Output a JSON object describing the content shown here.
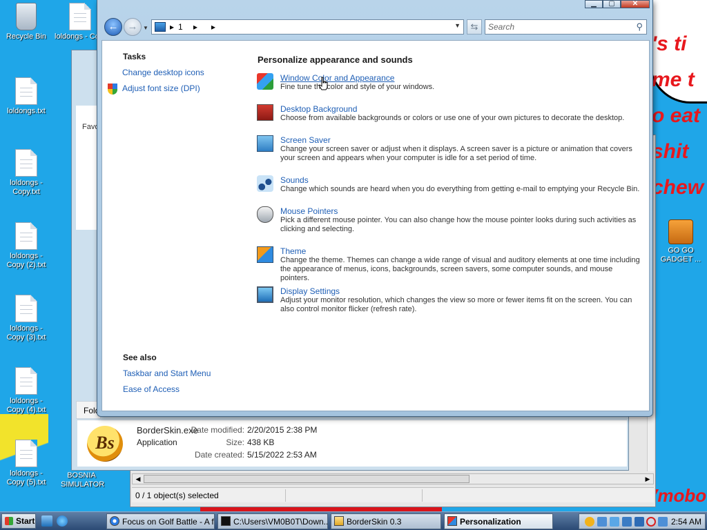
{
  "desktop": {
    "icons": [
      {
        "id": "recycle-bin",
        "label": "Recycle Bin"
      },
      {
        "id": "loldongs-copy-top",
        "label": "loldongs - Co..."
      },
      {
        "id": "loldongs",
        "label": "loldongs.txt"
      },
      {
        "id": "loldongs-copy",
        "label": "loldongs - Copy.txt"
      },
      {
        "id": "loldongs-copy-2",
        "label": "loldongs - Copy (2).txt"
      },
      {
        "id": "loldongs-copy-3",
        "label": "loldongs - Copy (3).txt"
      },
      {
        "id": "loldongs-copy-4",
        "label": "loldongs - Copy (4).txt"
      },
      {
        "id": "loldongs-copy-5",
        "label": "loldongs - Copy (5).txt"
      },
      {
        "id": "bosnia-simulator",
        "label": "BOSNIA SIMULATOR"
      },
      {
        "id": "go-go-gadget",
        "label": "GO GO GADGET ..."
      }
    ],
    "wallpaper_text": "'s time to eat shit chew",
    "wallpaper_corner": "Vmobot"
  },
  "background_explorer": {
    "favorites_label": "Favor",
    "folders_label": "Folde",
    "file": {
      "logo_text": "Bs",
      "name": "BorderSkin.exe",
      "type": "Application",
      "modified_label": "Date modified:",
      "modified_value": "2/20/2015 2:38 PM",
      "size_label": "Size:",
      "size_value": "438 KB",
      "created_label": "Date created:",
      "created_value": "5/15/2022 2:53 AM"
    }
  },
  "background_window": {
    "status_text": "0 / 1 object(s) selected"
  },
  "window": {
    "caption_buttons": {
      "minimize": "▁",
      "maximize": "▢",
      "close": "✕"
    },
    "address_crumb": "1",
    "search_placeholder": "Search",
    "tasks_title": "Tasks",
    "tasks": [
      {
        "label": "Change desktop icons"
      },
      {
        "label": "Adjust font size (DPI)"
      }
    ],
    "see_also_title": "See also",
    "see_also": [
      {
        "label": "Taskbar and Start Menu"
      },
      {
        "label": "Ease of Access"
      }
    ],
    "main_title": "Personalize appearance and sounds",
    "items": [
      {
        "title": "Window Color and Appearance",
        "desc": "Fine tune the color and style of your windows.",
        "icon": "color-palette-icon"
      },
      {
        "title": "Desktop Background",
        "desc": "Choose from available backgrounds or colors or use one of your own pictures to decorate the desktop.",
        "icon": "desktop-background-icon"
      },
      {
        "title": "Screen Saver",
        "desc": "Change your screen saver or adjust when it displays. A screen saver is a picture or animation that covers your screen and appears when your computer is idle for a set period of time.",
        "icon": "screen-saver-icon"
      },
      {
        "title": "Sounds",
        "desc": "Change which sounds are heard when you do everything from getting e-mail to emptying your Recycle Bin.",
        "icon": "sounds-icon"
      },
      {
        "title": "Mouse Pointers",
        "desc": "Pick a different mouse pointer. You can also change how the mouse pointer looks during such activities as clicking and selecting.",
        "icon": "mouse-pointers-icon"
      },
      {
        "title": "Theme",
        "desc": "Change the theme. Themes can change a wide range of visual and auditory elements at one time including the appearance of menus, icons, backgrounds, screen savers, some computer sounds, and mouse pointers.",
        "icon": "theme-icon"
      },
      {
        "title": "Display Settings",
        "desc": "Adjust your monitor resolution, which changes the view so more or fewer items fit on the screen. You can also control monitor flicker (refresh rate).",
        "icon": "display-settings-icon"
      }
    ]
  },
  "taskbar": {
    "start_label": "Start",
    "buttons": [
      {
        "label": "Focus on Golf Battle - A fr..."
      },
      {
        "label": "C:\\Users\\VM0B0T\\Down..."
      },
      {
        "label": "BorderSkin 0.3"
      },
      {
        "label": "Personalization"
      }
    ],
    "clock": "2:54 AM"
  },
  "colors": {
    "desktop": "#1fa6e8",
    "link": "#1e5eb5",
    "window_frame": "#a4c3de",
    "taskbar": "#2b4a74"
  }
}
